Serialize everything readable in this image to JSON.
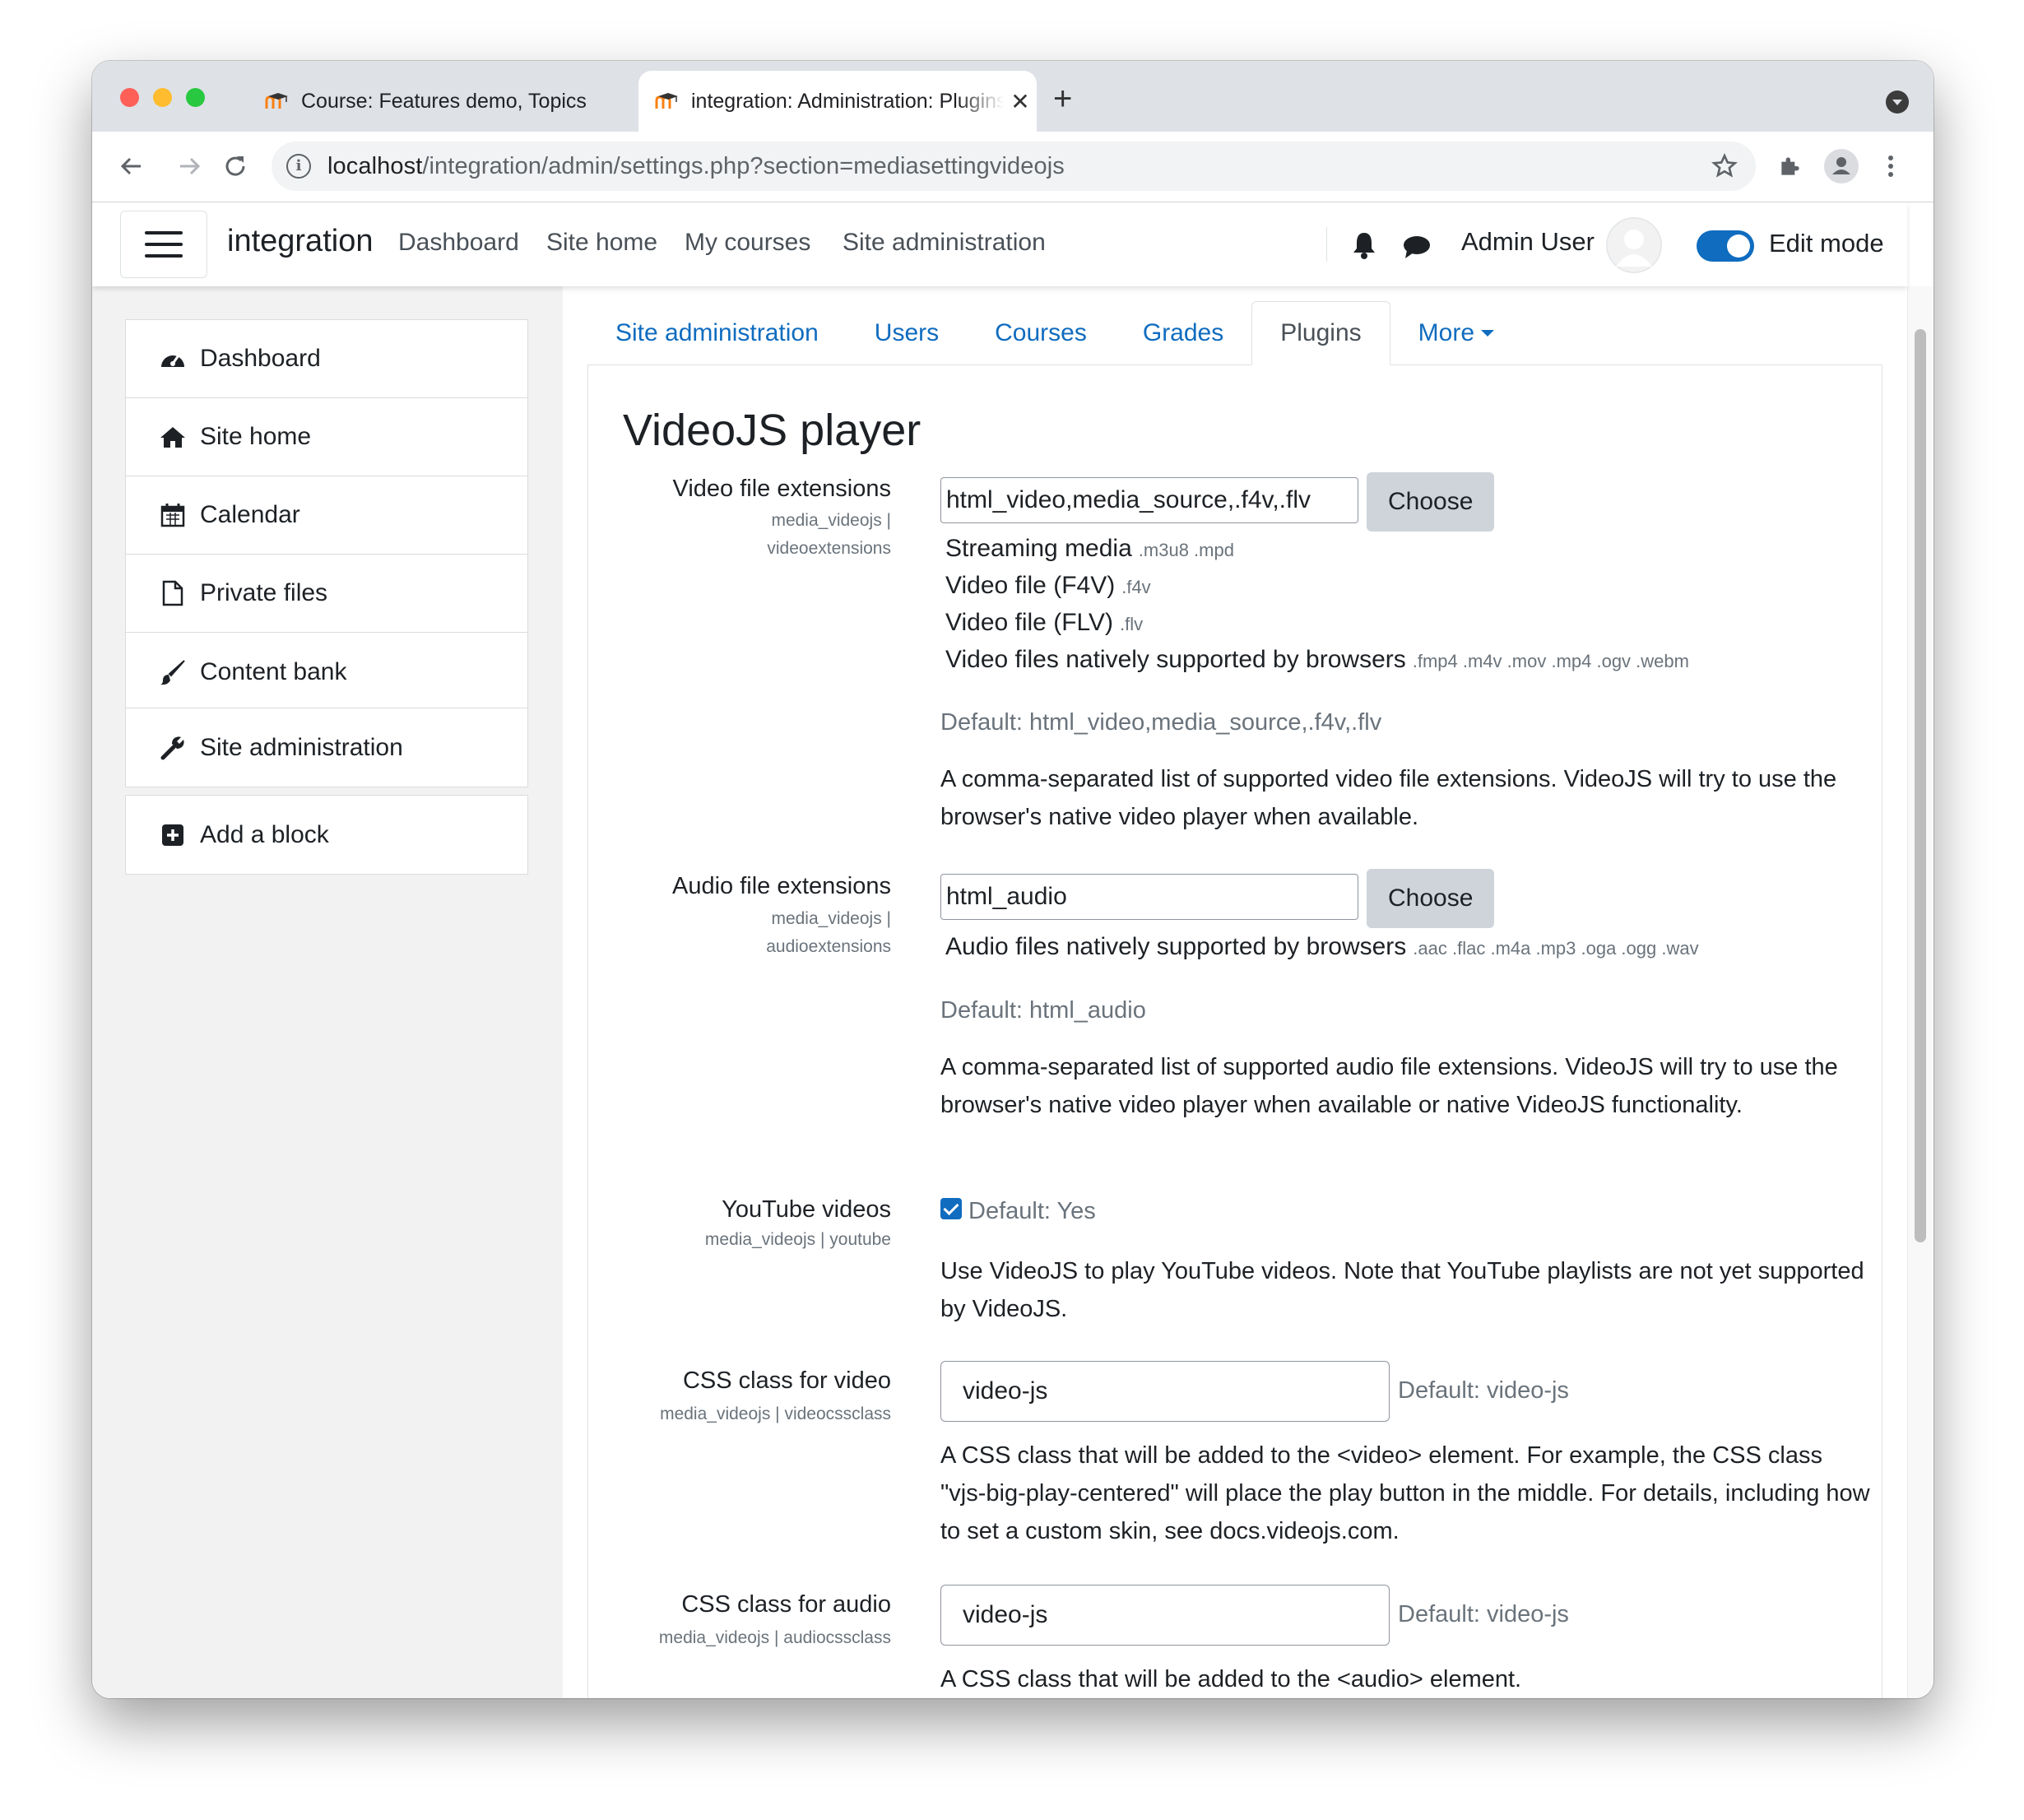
{
  "browser": {
    "tabs": [
      {
        "title": "Course: Features demo, Topics"
      },
      {
        "title": "integration: Administration: Plugins"
      }
    ],
    "url_host": "localhost",
    "url_path": "/integration/admin/settings.php?section=mediasettingvideojs"
  },
  "navbar": {
    "brand": "integration",
    "links": [
      "Dashboard",
      "Site home",
      "My courses",
      "Site administration"
    ],
    "user": "Admin User",
    "edit_mode": "Edit mode"
  },
  "drawer": {
    "items": [
      "Dashboard",
      "Site home",
      "Calendar",
      "Private files",
      "Content bank"
    ],
    "admin": "Site administration",
    "add_block": "Add a block"
  },
  "secondary_tabs": [
    "Site administration",
    "Users",
    "Courses",
    "Grades",
    "Plugins",
    "More"
  ],
  "page_title": "VideoJS player",
  "settings": {
    "video_ext": {
      "label": "Video file extensions",
      "sub1": "media_videojs |",
      "sub2": "videoextensions",
      "value": "html_video,media_source,.f4v,.flv",
      "choose": "Choose",
      "types": [
        {
          "name": "Streaming media",
          "ext": ".m3u8 .mpd"
        },
        {
          "name": "Video file (F4V)",
          "ext": ".f4v"
        },
        {
          "name": "Video file (FLV)",
          "ext": ".flv"
        },
        {
          "name": "Video files natively supported by browsers",
          "ext": ".fmp4 .m4v .mov .mp4 .ogv .webm"
        }
      ],
      "default": "Default: html_video,media_source,.f4v,.flv",
      "desc": "A comma-separated list of supported video file extensions. VideoJS will try to use the browser's native video player when available."
    },
    "audio_ext": {
      "label": "Audio file extensions",
      "sub1": "media_videojs |",
      "sub2": "audioextensions",
      "value": "html_audio",
      "choose": "Choose",
      "types": [
        {
          "name": "Audio files natively supported by browsers",
          "ext": ".aac .flac .m4a .mp3 .oga .ogg .wav"
        }
      ],
      "default": "Default: html_audio",
      "desc": "A comma-separated list of supported audio file extensions. VideoJS will try to use the browser's native video player when available or native VideoJS functionality."
    },
    "youtube": {
      "label": "YouTube videos",
      "sub": "media_videojs | youtube",
      "default": "Default: Yes",
      "checked": true,
      "desc": "Use VideoJS to play YouTube videos. Note that YouTube playlists are not yet supported by VideoJS."
    },
    "video_css": {
      "label": "CSS class for video",
      "sub": "media_videojs | videocssclass",
      "value": "video-js",
      "default": "Default: video-js",
      "desc": "A CSS class that will be added to the <video> element. For example, the CSS class \"vjs-big-play-centered\" will place the play button in the middle. For details, including how to set a custom skin, see docs.videojs.com."
    },
    "audio_css": {
      "label": "CSS class for audio",
      "sub": "media_videojs | audiocssclass",
      "value": "video-js",
      "default": "Default: video-js",
      "desc": "A CSS class that will be added to the <audio> element."
    }
  },
  "colors": {
    "accent": "#0f6cbf",
    "drawer_bg": "#f2f2f2"
  }
}
